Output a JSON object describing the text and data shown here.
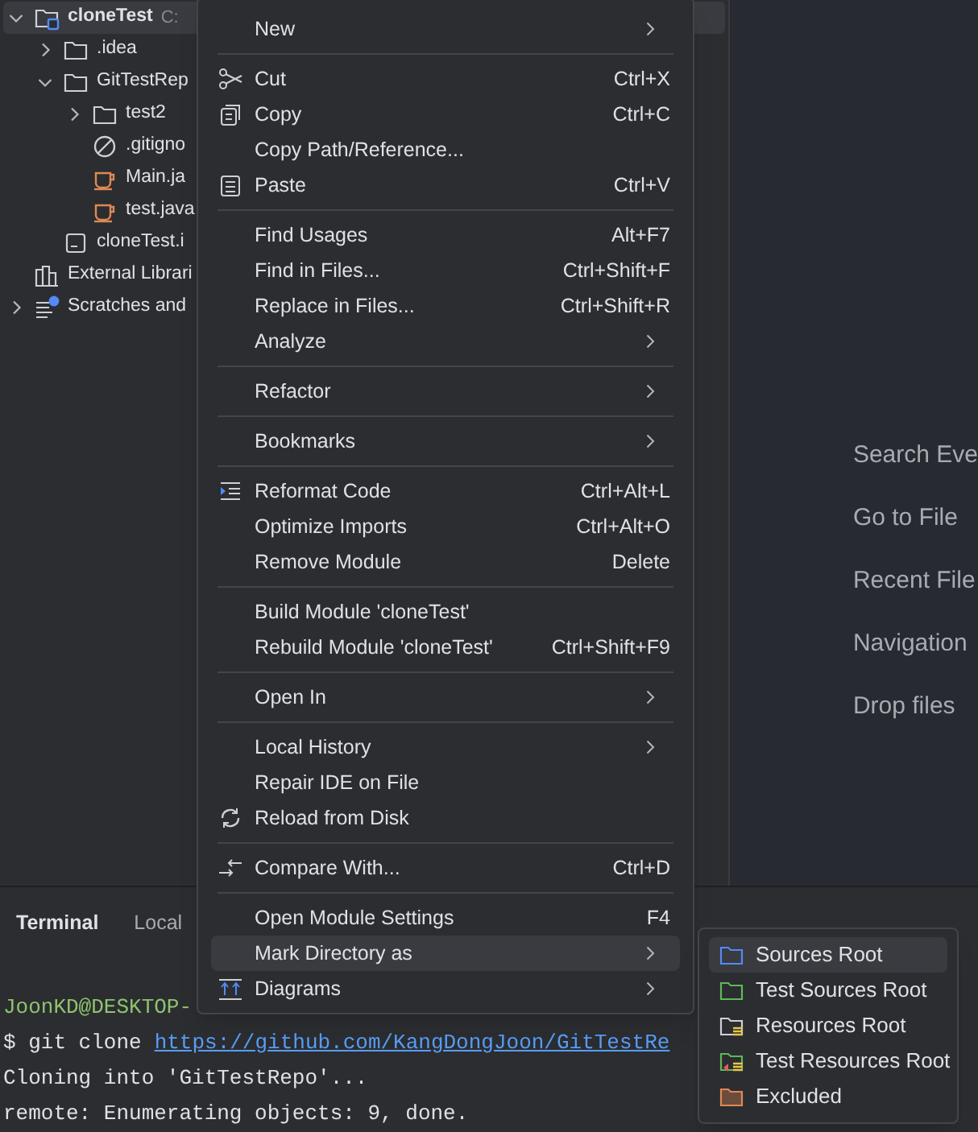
{
  "project_tree": [
    {
      "label": "cloneTest",
      "hint": "C:",
      "kind": "module",
      "expanded": true,
      "selected": true,
      "children": [
        {
          "label": ".idea",
          "kind": "folder",
          "expanded": false,
          "selected": false
        },
        {
          "label": "GitTestRep",
          "kind": "folder",
          "expanded": true,
          "selected": false,
          "children": [
            {
              "label": "test2",
              "kind": "folder",
              "expanded": false,
              "selected": false
            },
            {
              "label": ".gitigno",
              "kind": "ignored",
              "selected": false
            },
            {
              "label": "Main.ja",
              "kind": "java",
              "selected": false
            },
            {
              "label": "test.java",
              "kind": "java",
              "selected": false
            }
          ]
        },
        {
          "label": "cloneTest.i",
          "kind": "iml",
          "selected": false
        }
      ]
    },
    {
      "label": "External Librari",
      "kind": "library",
      "selected": false
    },
    {
      "label": "Scratches and",
      "kind": "scratches",
      "expanded": false,
      "selected": false
    }
  ],
  "editor_hints": [
    "Search Eve",
    "Go to File",
    "Recent File",
    "Navigation",
    "Drop files"
  ],
  "terminal": {
    "tabs": [
      {
        "label": "Terminal",
        "selected": true
      },
      {
        "label": "Local",
        "selected": false
      }
    ],
    "lines": [
      {
        "kind": "user",
        "text": "JoonKD@DESKTOP-"
      },
      {
        "kind": "command",
        "text": "$ git clone",
        "link": "https://github.com/KangDongJoon/GitTestRe"
      },
      {
        "kind": "output",
        "text": "Cloning into 'GitTestRepo'..."
      },
      {
        "kind": "output",
        "text": "remote: Enumerating objects: 9, done."
      }
    ]
  },
  "context_menu": [
    {
      "kind": "item",
      "label": "New",
      "submenu": true,
      "selected": false
    },
    {
      "kind": "separator"
    },
    {
      "kind": "cut",
      "label": "Cut",
      "shortcut": "Ctrl+X",
      "selected": false
    },
    {
      "kind": "copy",
      "label": "Copy",
      "shortcut": "Ctrl+C",
      "selected": false
    },
    {
      "kind": "item",
      "label": "Copy Path/Reference...",
      "selected": false
    },
    {
      "kind": "paste",
      "label": "Paste",
      "shortcut": "Ctrl+V",
      "selected": false
    },
    {
      "kind": "separator"
    },
    {
      "kind": "item",
      "label": "Find Usages",
      "shortcut": "Alt+F7",
      "selected": false
    },
    {
      "kind": "item",
      "label": "Find in Files...",
      "shortcut": "Ctrl+Shift+F",
      "selected": false
    },
    {
      "kind": "item",
      "label": "Replace in Files...",
      "shortcut": "Ctrl+Shift+R",
      "selected": false
    },
    {
      "kind": "item",
      "label": "Analyze",
      "submenu": true,
      "selected": false
    },
    {
      "kind": "separator"
    },
    {
      "kind": "item",
      "label": "Refactor",
      "submenu": true,
      "selected": false
    },
    {
      "kind": "separator"
    },
    {
      "kind": "item",
      "label": "Bookmarks",
      "submenu": true,
      "selected": false
    },
    {
      "kind": "separator"
    },
    {
      "kind": "reformat",
      "label": "Reformat Code",
      "shortcut": "Ctrl+Alt+L",
      "selected": false
    },
    {
      "kind": "item",
      "label": "Optimize Imports",
      "shortcut": "Ctrl+Alt+O",
      "selected": false
    },
    {
      "kind": "item",
      "label": "Remove Module",
      "shortcut": "Delete",
      "selected": false
    },
    {
      "kind": "separator"
    },
    {
      "kind": "item",
      "label": "Build Module 'cloneTest'",
      "selected": false
    },
    {
      "kind": "item",
      "label": "Rebuild Module 'cloneTest'",
      "shortcut": "Ctrl+Shift+F9",
      "selected": false
    },
    {
      "kind": "separator"
    },
    {
      "kind": "item",
      "label": "Open In",
      "submenu": true,
      "selected": false
    },
    {
      "kind": "separator"
    },
    {
      "kind": "item",
      "label": "Local History",
      "submenu": true,
      "selected": false
    },
    {
      "kind": "item",
      "label": "Repair IDE on File",
      "selected": false
    },
    {
      "kind": "reload",
      "label": "Reload from Disk",
      "selected": false
    },
    {
      "kind": "separator"
    },
    {
      "kind": "compare",
      "label": "Compare With...",
      "shortcut": "Ctrl+D",
      "selected": false
    },
    {
      "kind": "separator"
    },
    {
      "kind": "item",
      "label": "Open Module Settings",
      "shortcut": "F4",
      "selected": false
    },
    {
      "kind": "item",
      "label": "Mark Directory as",
      "submenu": true,
      "selected": true
    },
    {
      "kind": "diagrams",
      "label": "Diagrams",
      "submenu": true,
      "selected": false
    }
  ],
  "submenu": [
    {
      "label": "Sources Root",
      "kind": "plain",
      "color": "#548af7",
      "selected": true
    },
    {
      "label": "Test Sources Root",
      "kind": "plain",
      "color": "#5fb857",
      "selected": false
    },
    {
      "label": "Resources Root",
      "kind": "lines",
      "color": "#ced0d6",
      "selected": false
    },
    {
      "label": "Test Resources Root",
      "kind": "test-lines",
      "color": "#5fb857",
      "selected": false
    },
    {
      "label": "Excluded",
      "kind": "filled",
      "color": "#e08855",
      "selected": false
    }
  ]
}
